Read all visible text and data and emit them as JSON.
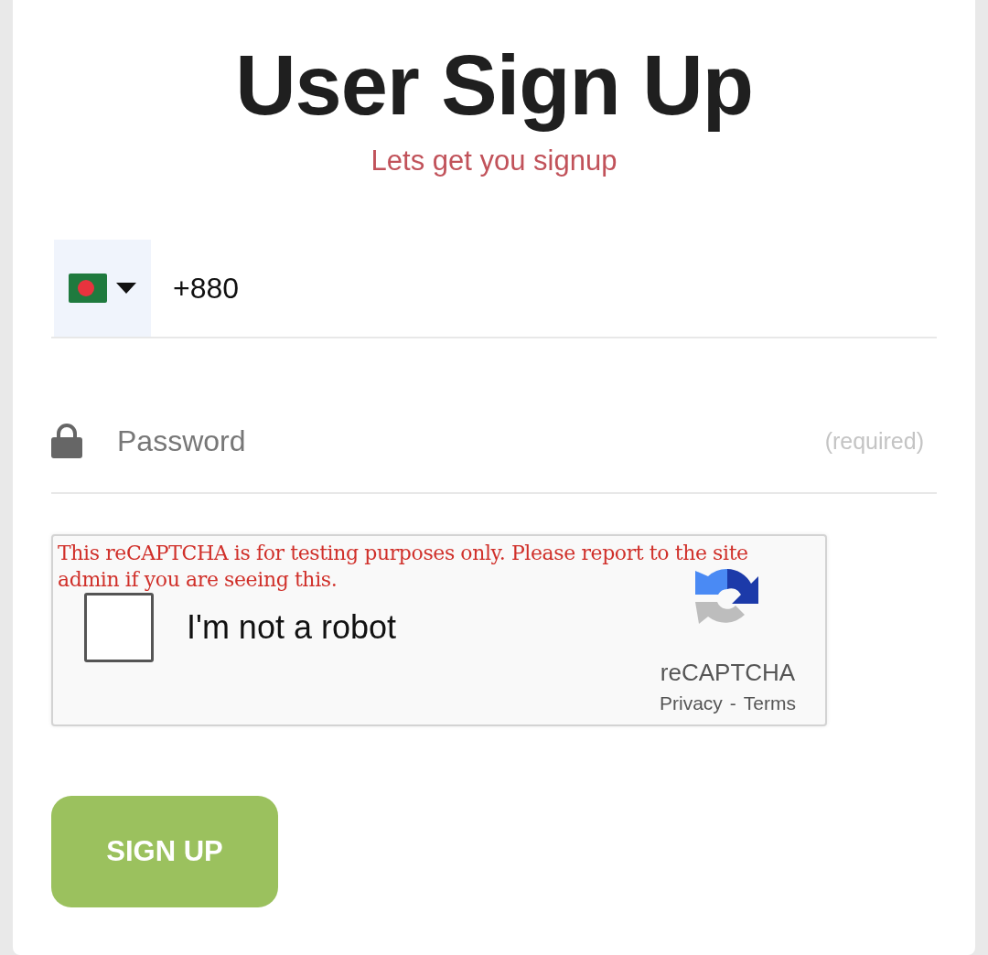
{
  "title": "User Sign Up",
  "subtitle": "Lets get you signup",
  "phone": {
    "value": "+880"
  },
  "password": {
    "placeholder": "Password",
    "hint": "(required)"
  },
  "recaptcha": {
    "warning": "This reCAPTCHA is for testing purposes only. Please report to the site admin if you are seeing this.",
    "label": "I'm not a robot",
    "checked": false,
    "brand": "reCAPTCHA",
    "links": [
      "Privacy",
      "Terms"
    ],
    "separator": "-"
  },
  "submit": "SIGN UP"
}
